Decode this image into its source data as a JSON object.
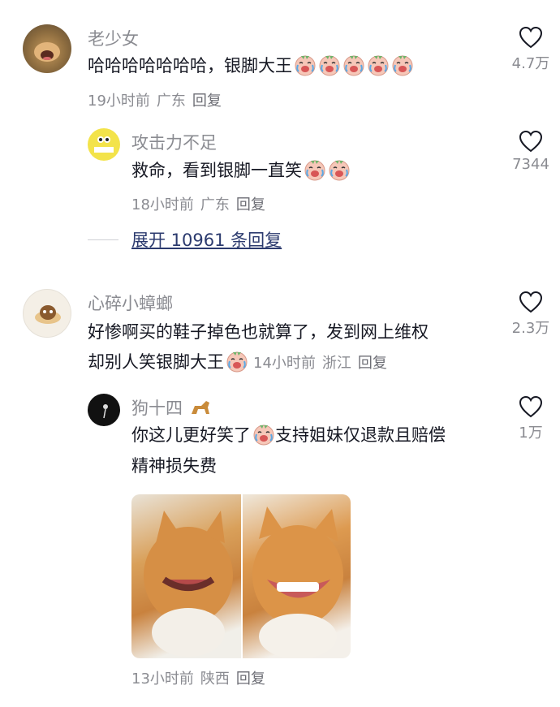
{
  "comments": [
    {
      "username": "老少女",
      "text": "哈哈哈哈哈哈哈，银脚大王",
      "time": "19小时前",
      "location": "广东",
      "reply": "回复",
      "likes": "4.7万"
    },
    {
      "username": "攻击力不足",
      "text": "救命，看到银脚一直笑",
      "time": "18小时前",
      "location": "广东",
      "reply": "回复",
      "likes": "7344",
      "expand": "展开 10961 条回复"
    },
    {
      "username": "心碎小蟑螂",
      "text_line1": "好惨啊买的鞋子掉色也就算了，发到网上维权",
      "text_line2": "却别人笑银脚大王",
      "time": "14小时前",
      "location": "浙江",
      "reply": "回复",
      "likes": "2.3万"
    },
    {
      "username": "狗十四",
      "text_line1": "你这儿更好笑了",
      "text_line1b": "支持姐妹仅退款且赔偿",
      "text_line2": "精神损失费",
      "time": "13小时前",
      "location": "陕西",
      "reply": "回复",
      "likes": "1万"
    }
  ],
  "icons": {
    "like": "heart-outline-icon",
    "emoji": "crying-laughing-emoji"
  },
  "colors": {
    "username": "#8a8b91",
    "meta": "#8a8b91",
    "expand": "#2b3a6e",
    "text": "#161823"
  }
}
